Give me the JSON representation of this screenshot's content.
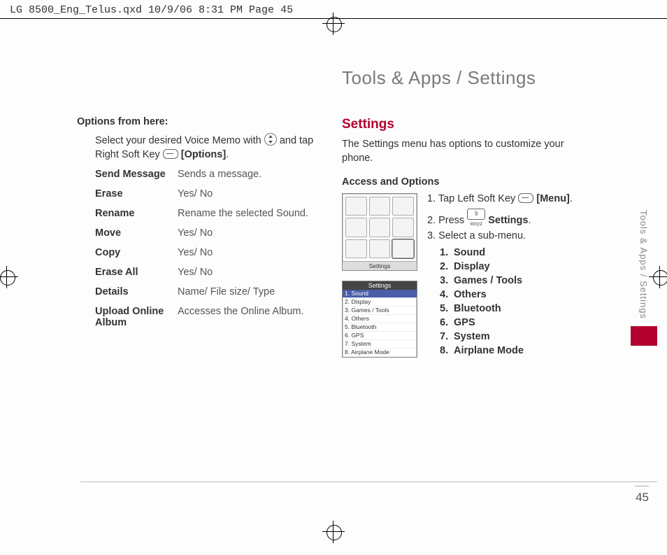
{
  "header": {
    "slug": "LG 8500_Eng_Telus.qxd  10/9/06  8:31 PM  Page 45"
  },
  "page": {
    "title": "Tools & Apps / Settings",
    "side_tab": "Tools & Apps / Settings",
    "number": "45"
  },
  "left": {
    "options_heading": "Options from here:",
    "intro_a": "Select your desired Voice Memo with ",
    "intro_b": " and tap Right Soft Key ",
    "intro_c": "[Options]",
    "intro_d": ".",
    "rows": [
      {
        "name": "Send Message",
        "desc": "Sends a message."
      },
      {
        "name": "Erase",
        "desc": "Yes/ No"
      },
      {
        "name": "Rename",
        "desc": "Rename the selected Sound."
      },
      {
        "name": "Move",
        "desc": "Yes/ No"
      },
      {
        "name": "Copy",
        "desc": "Yes/ No"
      },
      {
        "name": "Erase All",
        "desc": "Yes/ No"
      },
      {
        "name": "Details",
        "desc": "Name/ File size/ Type"
      },
      {
        "name": "Upload Online Album",
        "desc": "Accesses the Online Album."
      }
    ]
  },
  "right": {
    "heading": "Settings",
    "intro": "The Settings menu has options to customize your phone.",
    "access_heading": "Access and Options",
    "steps": {
      "s1a": "1. Tap Left Soft Key ",
      "s1b": "[Menu]",
      "s1c": ".",
      "s2a": "2. Press ",
      "s2b": "Settings",
      "s2c": ".",
      "s3": "3. Select a sub-menu."
    },
    "key9": "9 wxyz",
    "submenu": [
      "Sound",
      "Display",
      "Games / Tools",
      "Others",
      "Bluetooth",
      "GPS",
      "System",
      "Airplane Mode"
    ],
    "screen1_label": "Settings",
    "screen2_title": "Settings",
    "screen2_items": [
      "1. Sound",
      "2. Display",
      "3. Games / Tools",
      "4. Others",
      "5. Bluetooth",
      "6. GPS",
      "7. System",
      "8. Airplane Mode"
    ]
  }
}
